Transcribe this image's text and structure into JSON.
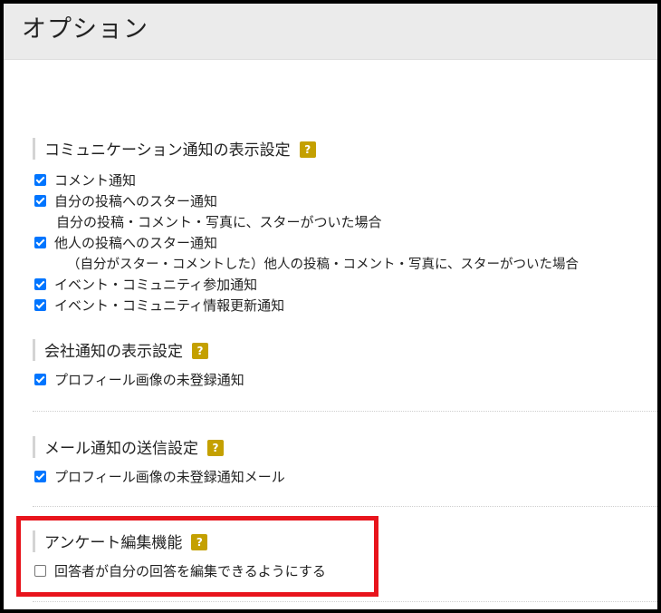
{
  "header": {
    "title": "オプション"
  },
  "help_label": "?",
  "sections": [
    {
      "title": "コミュニケーション通知の表示設定",
      "options": [
        {
          "label": "コメント通知",
          "checked": true
        },
        {
          "label": "自分の投稿へのスター通知",
          "checked": true,
          "description": "自分の投稿・コメント・写真に、スターがついた場合"
        },
        {
          "label": "他人の投稿へのスター通知",
          "checked": true,
          "description": "（自分がスター・コメントした）他人の投稿・コメント・写真に、スターがついた場合"
        },
        {
          "label": "イベント・コミュニティ参加通知",
          "checked": true
        },
        {
          "label": "イベント・コミュニティ情報更新通知",
          "checked": true
        }
      ]
    },
    {
      "title": "会社通知の表示設定",
      "options": [
        {
          "label": "プロフィール画像の未登録通知",
          "checked": true
        }
      ]
    },
    {
      "title": "メール通知の送信設定",
      "options": [
        {
          "label": "プロフィール画像の未登録通知メール",
          "checked": true
        }
      ]
    },
    {
      "title": "アンケート編集機能",
      "options": [
        {
          "label": "回答者が自分の回答を編集できるようにする",
          "checked": false
        }
      ]
    }
  ],
  "colors": {
    "checkbox_checked": "#0075ff",
    "help_icon": "#c4a000",
    "highlight_border": "#e8141c",
    "header_bg": "#ebebeb"
  }
}
